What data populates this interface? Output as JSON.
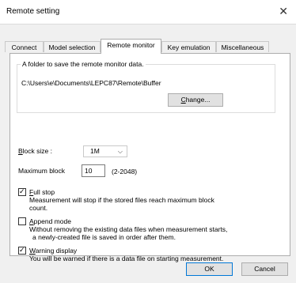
{
  "window": {
    "title": "Remote setting"
  },
  "tabs": [
    {
      "label": "Connect"
    },
    {
      "label": "Model selection"
    },
    {
      "label": "Remote monitor"
    },
    {
      "label": "Key emulation"
    },
    {
      "label": "Miscellaneous"
    }
  ],
  "folder_group": {
    "label": "A folder to save the remote monitor data.",
    "path": "C:\\Users\\e\\Documents\\LEPC87\\Remote\\Buffer",
    "change_button": "Change..."
  },
  "block_size": {
    "label": "Block size :",
    "value": "1M"
  },
  "max_block": {
    "label": "Maximum block",
    "value": "10",
    "range": "(2-2048)"
  },
  "options": {
    "full_stop": {
      "label": "Full stop",
      "checked": true,
      "desc_line1": "Measurement will stop if the stored files reach maximum block",
      "desc_line2": "count."
    },
    "append_mode": {
      "label": "Append mode",
      "checked": false,
      "desc_line1": "Without removing the existing data files when measurement starts,",
      "desc_line2": "a newly-created file is saved in order after them."
    },
    "warning_display": {
      "label": "Warning display",
      "checked": true,
      "desc_line1": "You will be warned if there is a data file on starting measurement."
    }
  },
  "buttons": {
    "ok": "OK",
    "cancel": "Cancel"
  }
}
